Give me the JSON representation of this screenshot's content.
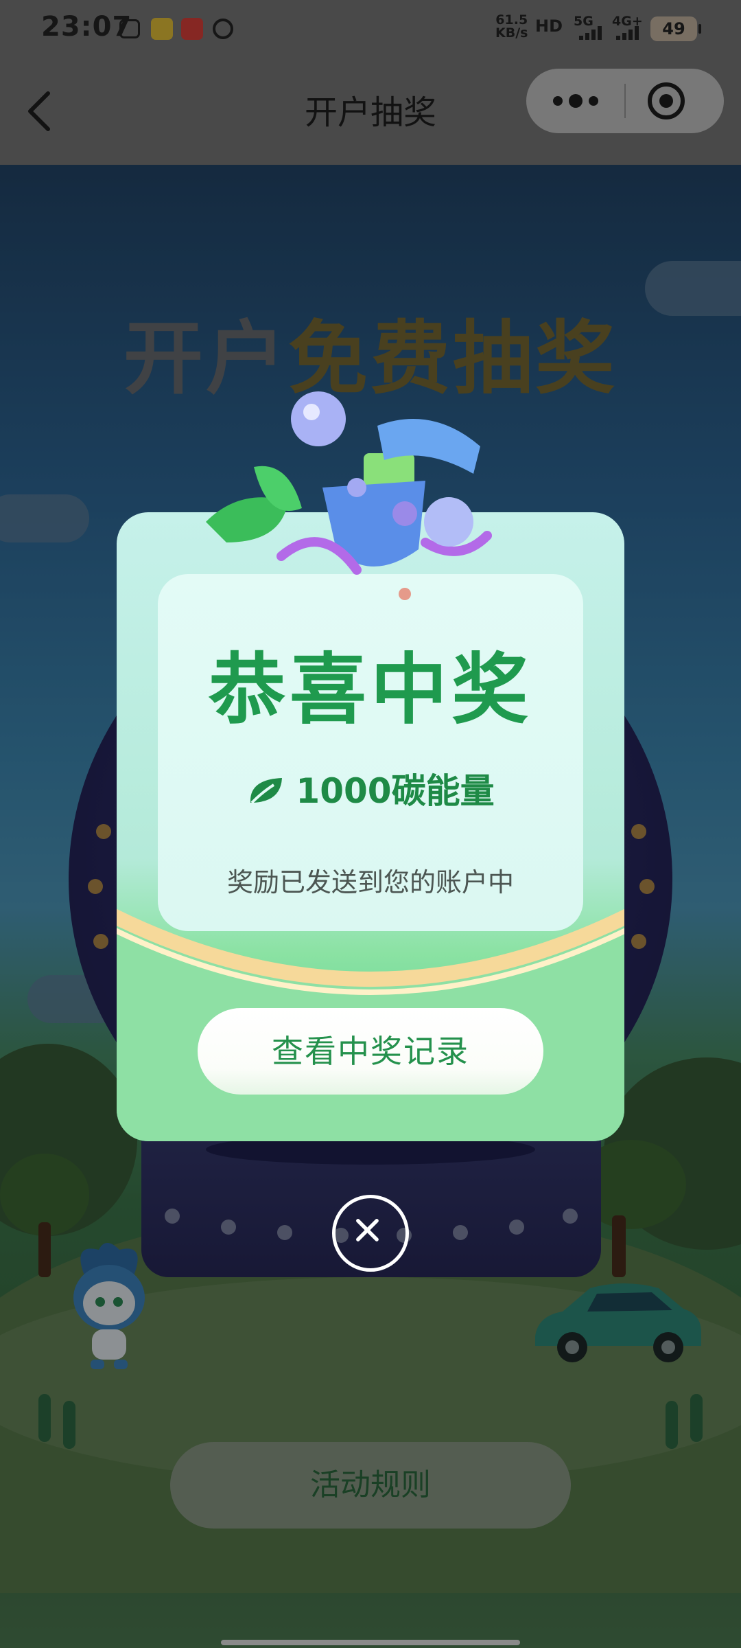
{
  "status_bar": {
    "time": "23:07",
    "net_speed_value": "61.5",
    "net_speed_unit": "KB/s",
    "hd_label": "HD",
    "sim1_label": "5G",
    "sim2_label": "4G+",
    "battery": "49"
  },
  "nav": {
    "title": "开户抽奖"
  },
  "background": {
    "headline_part1": "开户",
    "headline_part2": "免费抽奖",
    "rules_button": "活动规则"
  },
  "modal": {
    "title": "恭喜中奖",
    "prize": "1000碳能量",
    "message": "奖励已发送到您的账户中",
    "view_records_button": "查看中奖记录"
  },
  "colors": {
    "modal_title": "#1f9a4e",
    "accent_green": "#24914c",
    "status_bar_bg": "#7a7a7a"
  }
}
